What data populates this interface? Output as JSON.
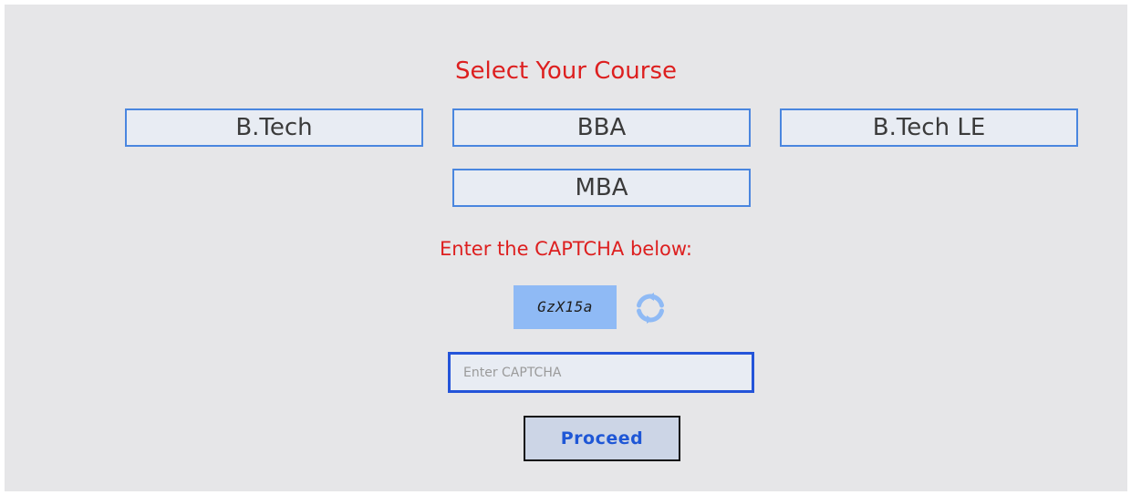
{
  "title": "Select Your Course",
  "courses": [
    "B.Tech",
    "BBA",
    "B.Tech LE",
    "MBA"
  ],
  "captcha": {
    "label": "Enter the CAPTCHA below:",
    "code": "GzX15a",
    "refresh_icon": "refresh-icon",
    "input_value": "",
    "input_placeholder": "Enter CAPTCHA"
  },
  "proceed_label": "Proceed",
  "colors": {
    "heading": "#dd1f1f",
    "button_border": "#4a86df",
    "captcha_bg": "#8fbaf5",
    "input_border": "#2454d9",
    "proceed_text": "#1f57d6"
  }
}
